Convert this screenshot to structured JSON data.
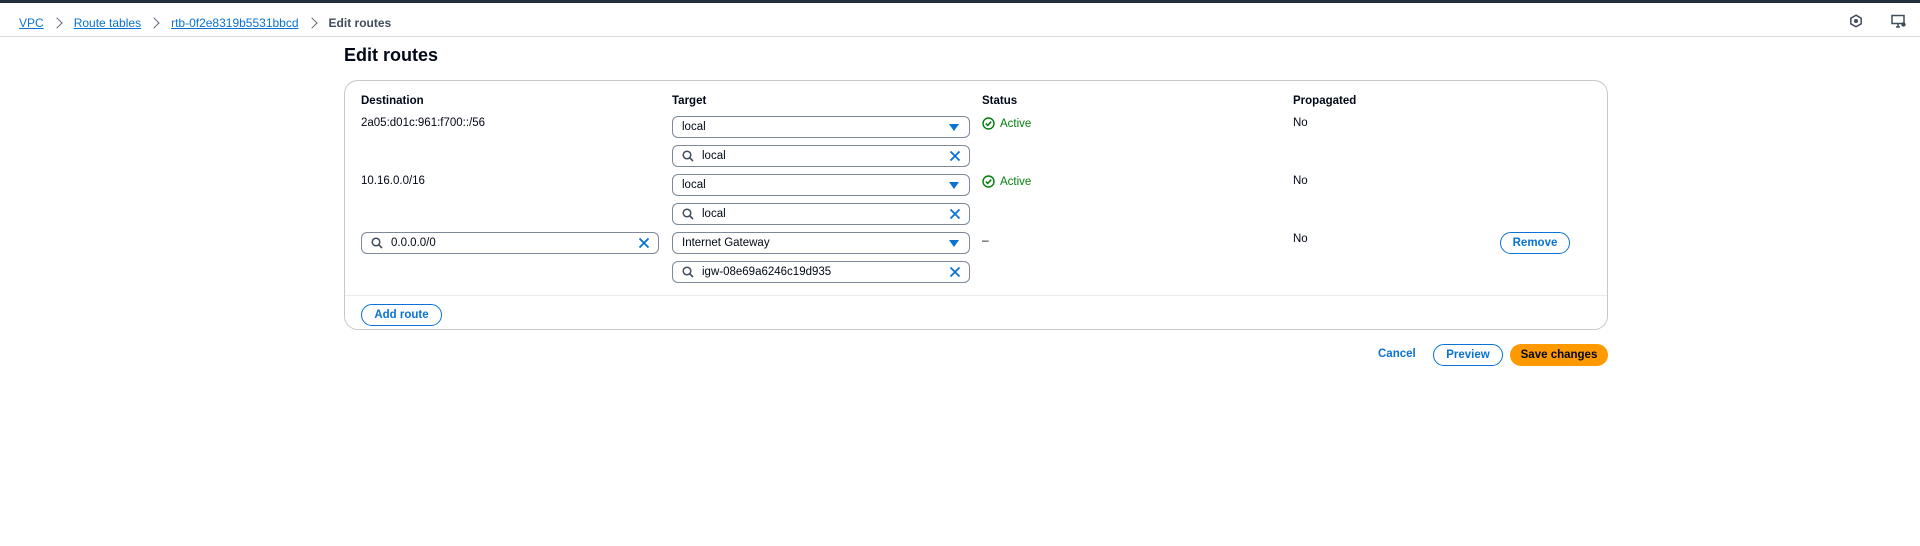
{
  "breadcrumb": {
    "items": [
      "VPC",
      "Route tables",
      "rtb-0f2e8319b5531bbcd"
    ],
    "current": "Edit routes"
  },
  "top_icons": [
    "notifications-icon",
    "feedback-icon"
  ],
  "page": {
    "title": "Edit routes"
  },
  "table": {
    "headers": {
      "destination": "Destination",
      "target": "Target",
      "status": "Status",
      "propagated": "Propagated"
    },
    "rows": [
      {
        "destination": "2a05:d01c:961:f700::/56",
        "target_type": "local",
        "target_value": "local",
        "status": "Active",
        "propagated": "No"
      },
      {
        "destination": "10.16.0.0/16",
        "target_type": "local",
        "target_value": "local",
        "status": "Active",
        "propagated": "No"
      },
      {
        "destination": "0.0.0.0/0",
        "target_type": "Internet Gateway",
        "target_value": "igw-08e69a6246c19d935",
        "status": "–",
        "propagated": "No",
        "remove_label": "Remove"
      }
    ],
    "add_route_label": "Add route"
  },
  "actions": {
    "cancel_label": "Cancel",
    "preview_label": "Preview",
    "save_label": "Save changes"
  },
  "colors": {
    "link": "#0972d3",
    "success": "#037f0c",
    "primary": "#ff9900",
    "border": "#c6c6cd"
  }
}
